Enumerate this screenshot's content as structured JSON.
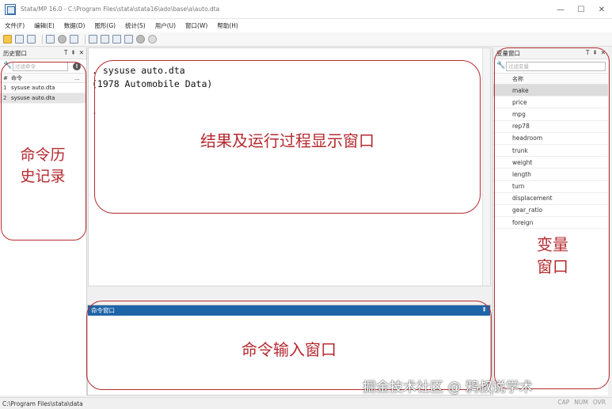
{
  "window": {
    "title": "Stata/MP 16.0 - C:\\Program Files\\stata\\stata16\\ado\\base\\a\\auto.dta",
    "minimize": "—",
    "maximize": "☐",
    "close": "✕"
  },
  "menu": [
    "文件(F)",
    "编辑(E)",
    "数据(D)",
    "图形(G)",
    "统计(S)",
    "用户(U)",
    "窗口(W)",
    "帮助(H)"
  ],
  "history": {
    "title": "历史窗口",
    "controls": [
      "T",
      "⇞",
      "✕"
    ],
    "filter_placeholder": "过滤命令",
    "col_hash": "#",
    "col_command": "命令",
    "col_more": "...",
    "rows": [
      {
        "num": "1",
        "cmd": "sysuse auto.dta"
      },
      {
        "num": "2",
        "cmd": "sysuse auto.dta"
      }
    ]
  },
  "results": {
    "lines": [
      ". sysuse auto.dta",
      "(1978 Automobile Data)",
      "",
      "."
    ]
  },
  "command_window": {
    "title": "命令窗口",
    "pin": "⇞"
  },
  "variables": {
    "title": "变量窗口",
    "controls": [
      "T",
      "⇞",
      "✕"
    ],
    "filter_placeholder": "过滤变量",
    "col_name": "名称",
    "items": [
      "make",
      "price",
      "mpg",
      "rep78",
      "headroom",
      "trunk",
      "weight",
      "length",
      "turn",
      "displacement",
      "gear_ratio",
      "foreign"
    ]
  },
  "statusbar": {
    "path": "C:\\Program Files\\stata\\data",
    "flags": [
      "CAP",
      "NUM",
      "OVR"
    ]
  },
  "annotations": {
    "history_label": "命令历史记录",
    "history_line1": "命令历",
    "history_line2": "史记录",
    "results_label": "结果及运行过程显示窗口",
    "variables_line1": "变量",
    "variables_line2": "窗口",
    "command_label": "命令输入窗口",
    "watermark": "掘金技术社区 @ 鸦叔说学术"
  },
  "colors": {
    "annotation": "#b52a2f",
    "command_header": "#1e64a8"
  }
}
